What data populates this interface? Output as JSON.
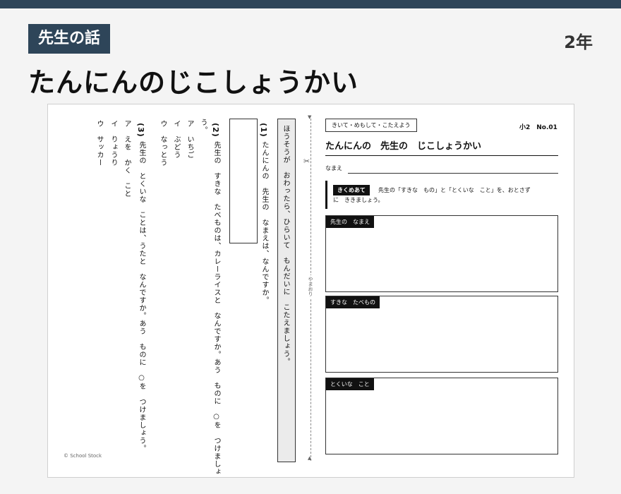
{
  "header": {
    "category": "先生の話",
    "grade": "2年",
    "title": "たんにんのじこしょうかい"
  },
  "sheet": {
    "instruction": "ほうそうが　おわったら、ひらいて　もんだいに　こたえましょう。",
    "q1": {
      "num": "(1)",
      "text": "たんにんの　先生の　なまえは、なんですか。"
    },
    "q2": {
      "num": "(2)",
      "text": "先生の　すきな　たべものは、カレーライスと　なんですか。あう　ものに　○を　つけましょ",
      "text_end": "う。",
      "options": [
        "ア　いちご",
        "イ　ぶどう",
        "ウ　なっとう"
      ]
    },
    "q3": {
      "num": "(3)",
      "text": "先生の　とくいな　ことは、うたと　なんですか。あう　ものに　○を　つけましょう。",
      "options": [
        "ア　えを　かく　こと",
        "イ　りょうり",
        "ウ　サッカー"
      ]
    },
    "copyright": "© School Stock",
    "fold_label": "やまおり",
    "fold_top": "▼",
    "fold_bottom": "▲",
    "scissor": "✂",
    "right": {
      "tag": "きいて・めもして・こたえよう",
      "number": "小2　No.01",
      "title": "たんにんの　先生の　じこしょうかい",
      "name_label": "なまえ",
      "point_label": "きくめあて",
      "point_text": "先生の「すきな　もの」と「とくいな　こと」を、おとさず",
      "point_text2": "に　ききましょう。",
      "boxes": [
        "先生の　なまえ",
        "すきな　たべもの",
        "とくいな　こと"
      ]
    }
  }
}
